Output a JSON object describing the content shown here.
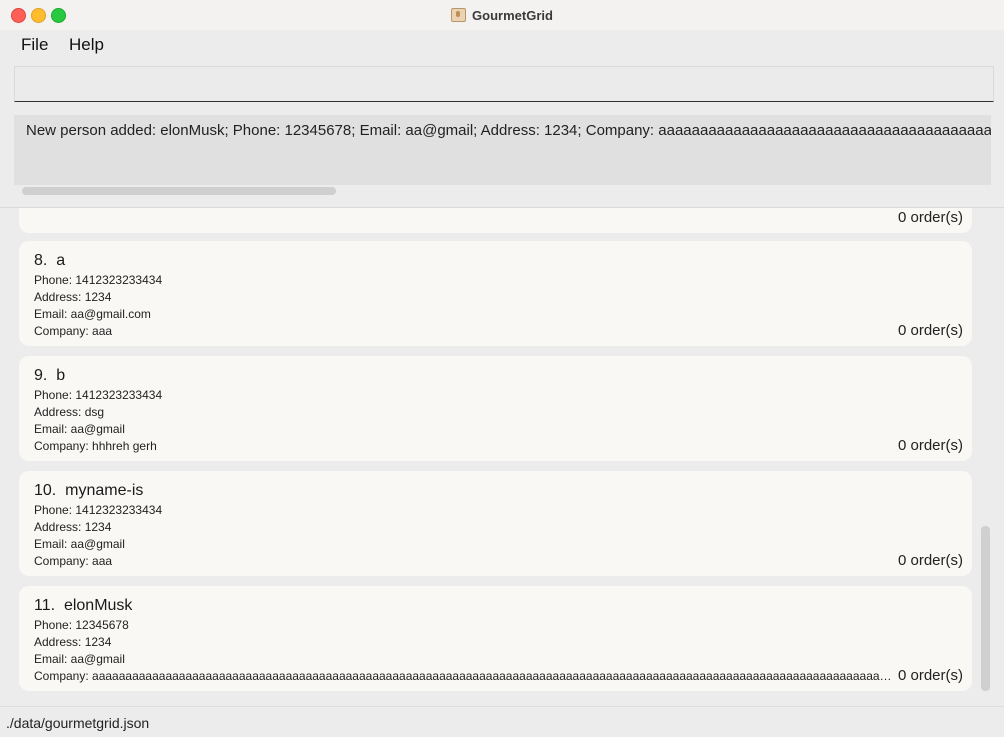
{
  "window": {
    "title": "GourmetGrid"
  },
  "menu": {
    "items": [
      "File",
      "Help"
    ]
  },
  "command_box": {
    "value": ""
  },
  "result": {
    "text": "New person added: elonMusk; Phone: 12345678; Email: aa@gmail; Address: 1234; Company: aaaaaaaaaaaaaaaaaaaaaaaaaaaaaaaaaaaaaaaaaaaaaaaaaaaaaaaaaaaaaaaa"
  },
  "partial_card": {
    "orders": "0 order(s)"
  },
  "persons": [
    {
      "index": "8.",
      "name": "a",
      "phone": "Phone: 1412323233434",
      "address": "Address: 1234",
      "email": "Email: aa@gmail.com",
      "company": "Company: aaa",
      "orders": "0 order(s)"
    },
    {
      "index": "9.",
      "name": "b",
      "phone": "Phone: 1412323233434",
      "address": "Address: dsg",
      "email": "Email: aa@gmail",
      "company": "Company: hhhreh gerh",
      "orders": "0 order(s)"
    },
    {
      "index": "10.",
      "name": "myname-is",
      "phone": "Phone: 1412323233434",
      "address": "Address: 1234",
      "email": "Email: aa@gmail",
      "company": "Company: aaa",
      "orders": "0 order(s)"
    },
    {
      "index": "11.",
      "name": "elonMusk",
      "phone": "Phone: 12345678",
      "address": "Address: 1234",
      "email": "Email: aa@gmail",
      "company": "Company: aaaaaaaaaaaaaaaaaaaaaaaaaaaaaaaaaaaaaaaaaaaaaaaaaaaaaaaaaaaaaaaaaaaaaaaaaaaaaaaaaaaaaaaaaaaaaaaaaaaaaaaaaaaaaaaaaaaaaaaaaaaaaa",
      "orders": "0 order(s)"
    }
  ],
  "status": {
    "path": "./data/gourmetgrid.json"
  }
}
